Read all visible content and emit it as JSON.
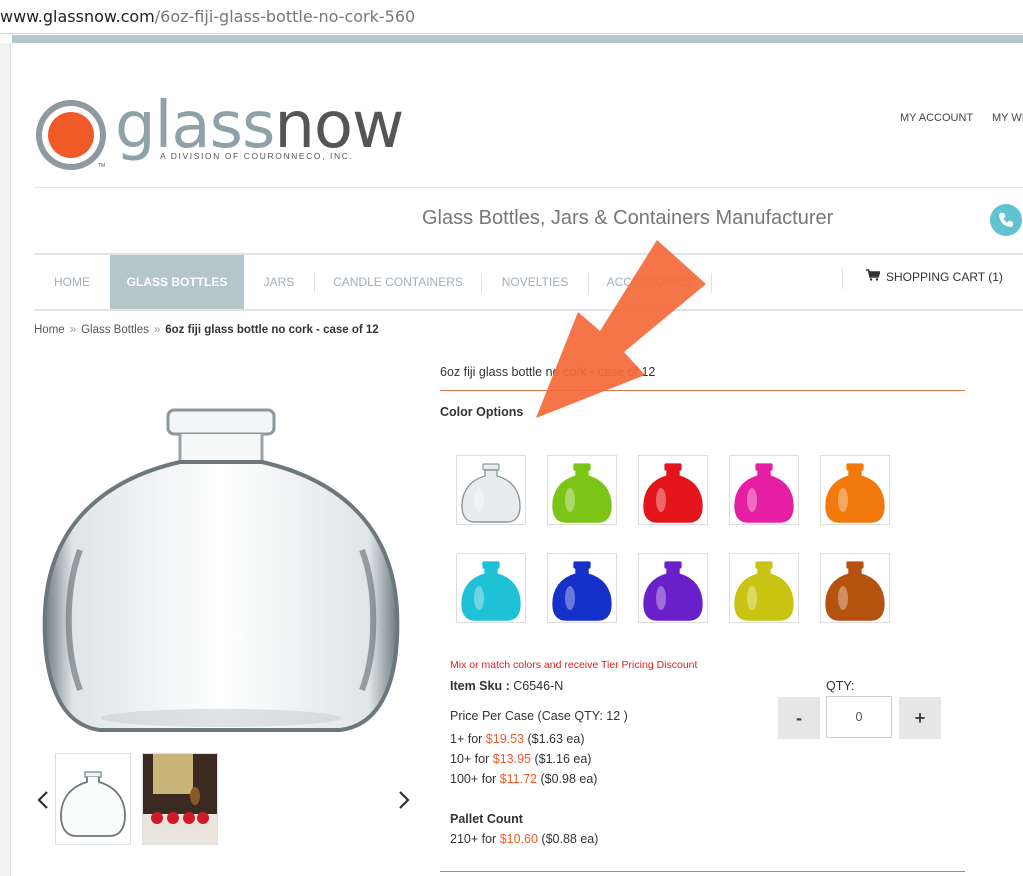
{
  "browser": {
    "url_domain": "www.glassnow.com",
    "url_path": "/6oz-fiji-glass-bottle-no-cork-560"
  },
  "brand": {
    "word_light": "glass",
    "word_dark": "now",
    "subtitle": "A DIVISION OF COURONNECO, INC.",
    "tm": "TM"
  },
  "header": {
    "links": [
      "MY ACCOUNT",
      "MY WIS"
    ],
    "tagline": "Glass Bottles, Jars & Containers Manufacturer"
  },
  "nav": {
    "items": [
      "HOME",
      "GLASS BOTTLES",
      "JARS",
      "CANDLE CONTAINERS",
      "NOVELTIES",
      "ACCESSORIES"
    ],
    "active": "GLASS BOTTLES",
    "cart": "SHOPPING CART (1)"
  },
  "breadcrumb": {
    "items": [
      "Home",
      "Glass Bottles"
    ],
    "current": "6oz fiji glass bottle no cork - case of 12"
  },
  "product": {
    "title": "6oz fiji glass bottle no cork - case of 12",
    "color_options_label": "Color Options",
    "colors": [
      {
        "name": "clear",
        "hex": "#e8ecee"
      },
      {
        "name": "green",
        "hex": "#7cc516"
      },
      {
        "name": "red",
        "hex": "#e3141b"
      },
      {
        "name": "pink",
        "hex": "#e61ea4"
      },
      {
        "name": "orange",
        "hex": "#f27a0c"
      },
      {
        "name": "aqua",
        "hex": "#1ec1d6"
      },
      {
        "name": "blue",
        "hex": "#1531c9"
      },
      {
        "name": "purple",
        "hex": "#6a20c9"
      },
      {
        "name": "yellow",
        "hex": "#c9c412"
      },
      {
        "name": "amber",
        "hex": "#b5520f"
      }
    ],
    "mix_note": "Mix or match colors and receive Tier Pricing Discount",
    "sku_label": "Item Sku :",
    "sku": "C6546-N",
    "price_per_case": "Price Per Case (Case QTY: 12 )",
    "tiers": [
      {
        "qty": "1+ for ",
        "price": "$19.53",
        "each": " ($1.63 ea)"
      },
      {
        "qty": "10+ for ",
        "price": "$13.95",
        "each": " ($1.16 ea)"
      },
      {
        "qty": "100+ for ",
        "price": "$11.72",
        "each": " ($0.98 ea)"
      }
    ],
    "qty_label": "QTY:",
    "qty_value": "0",
    "minus": "-",
    "plus": "+",
    "pallet_label": "Pallet Count",
    "pallet": {
      "qty": "210+ for ",
      "price": "$10.60",
      "each": " ($0.88 ea)"
    }
  },
  "colors": {
    "accent": "#f05a28",
    "nav_active": "#b4c5cb",
    "phone": "#5fc4d0"
  },
  "icons": {
    "phone": "phone-icon",
    "cart": "cart-icon",
    "prev": "chevron-left-icon",
    "next": "chevron-right-icon"
  }
}
